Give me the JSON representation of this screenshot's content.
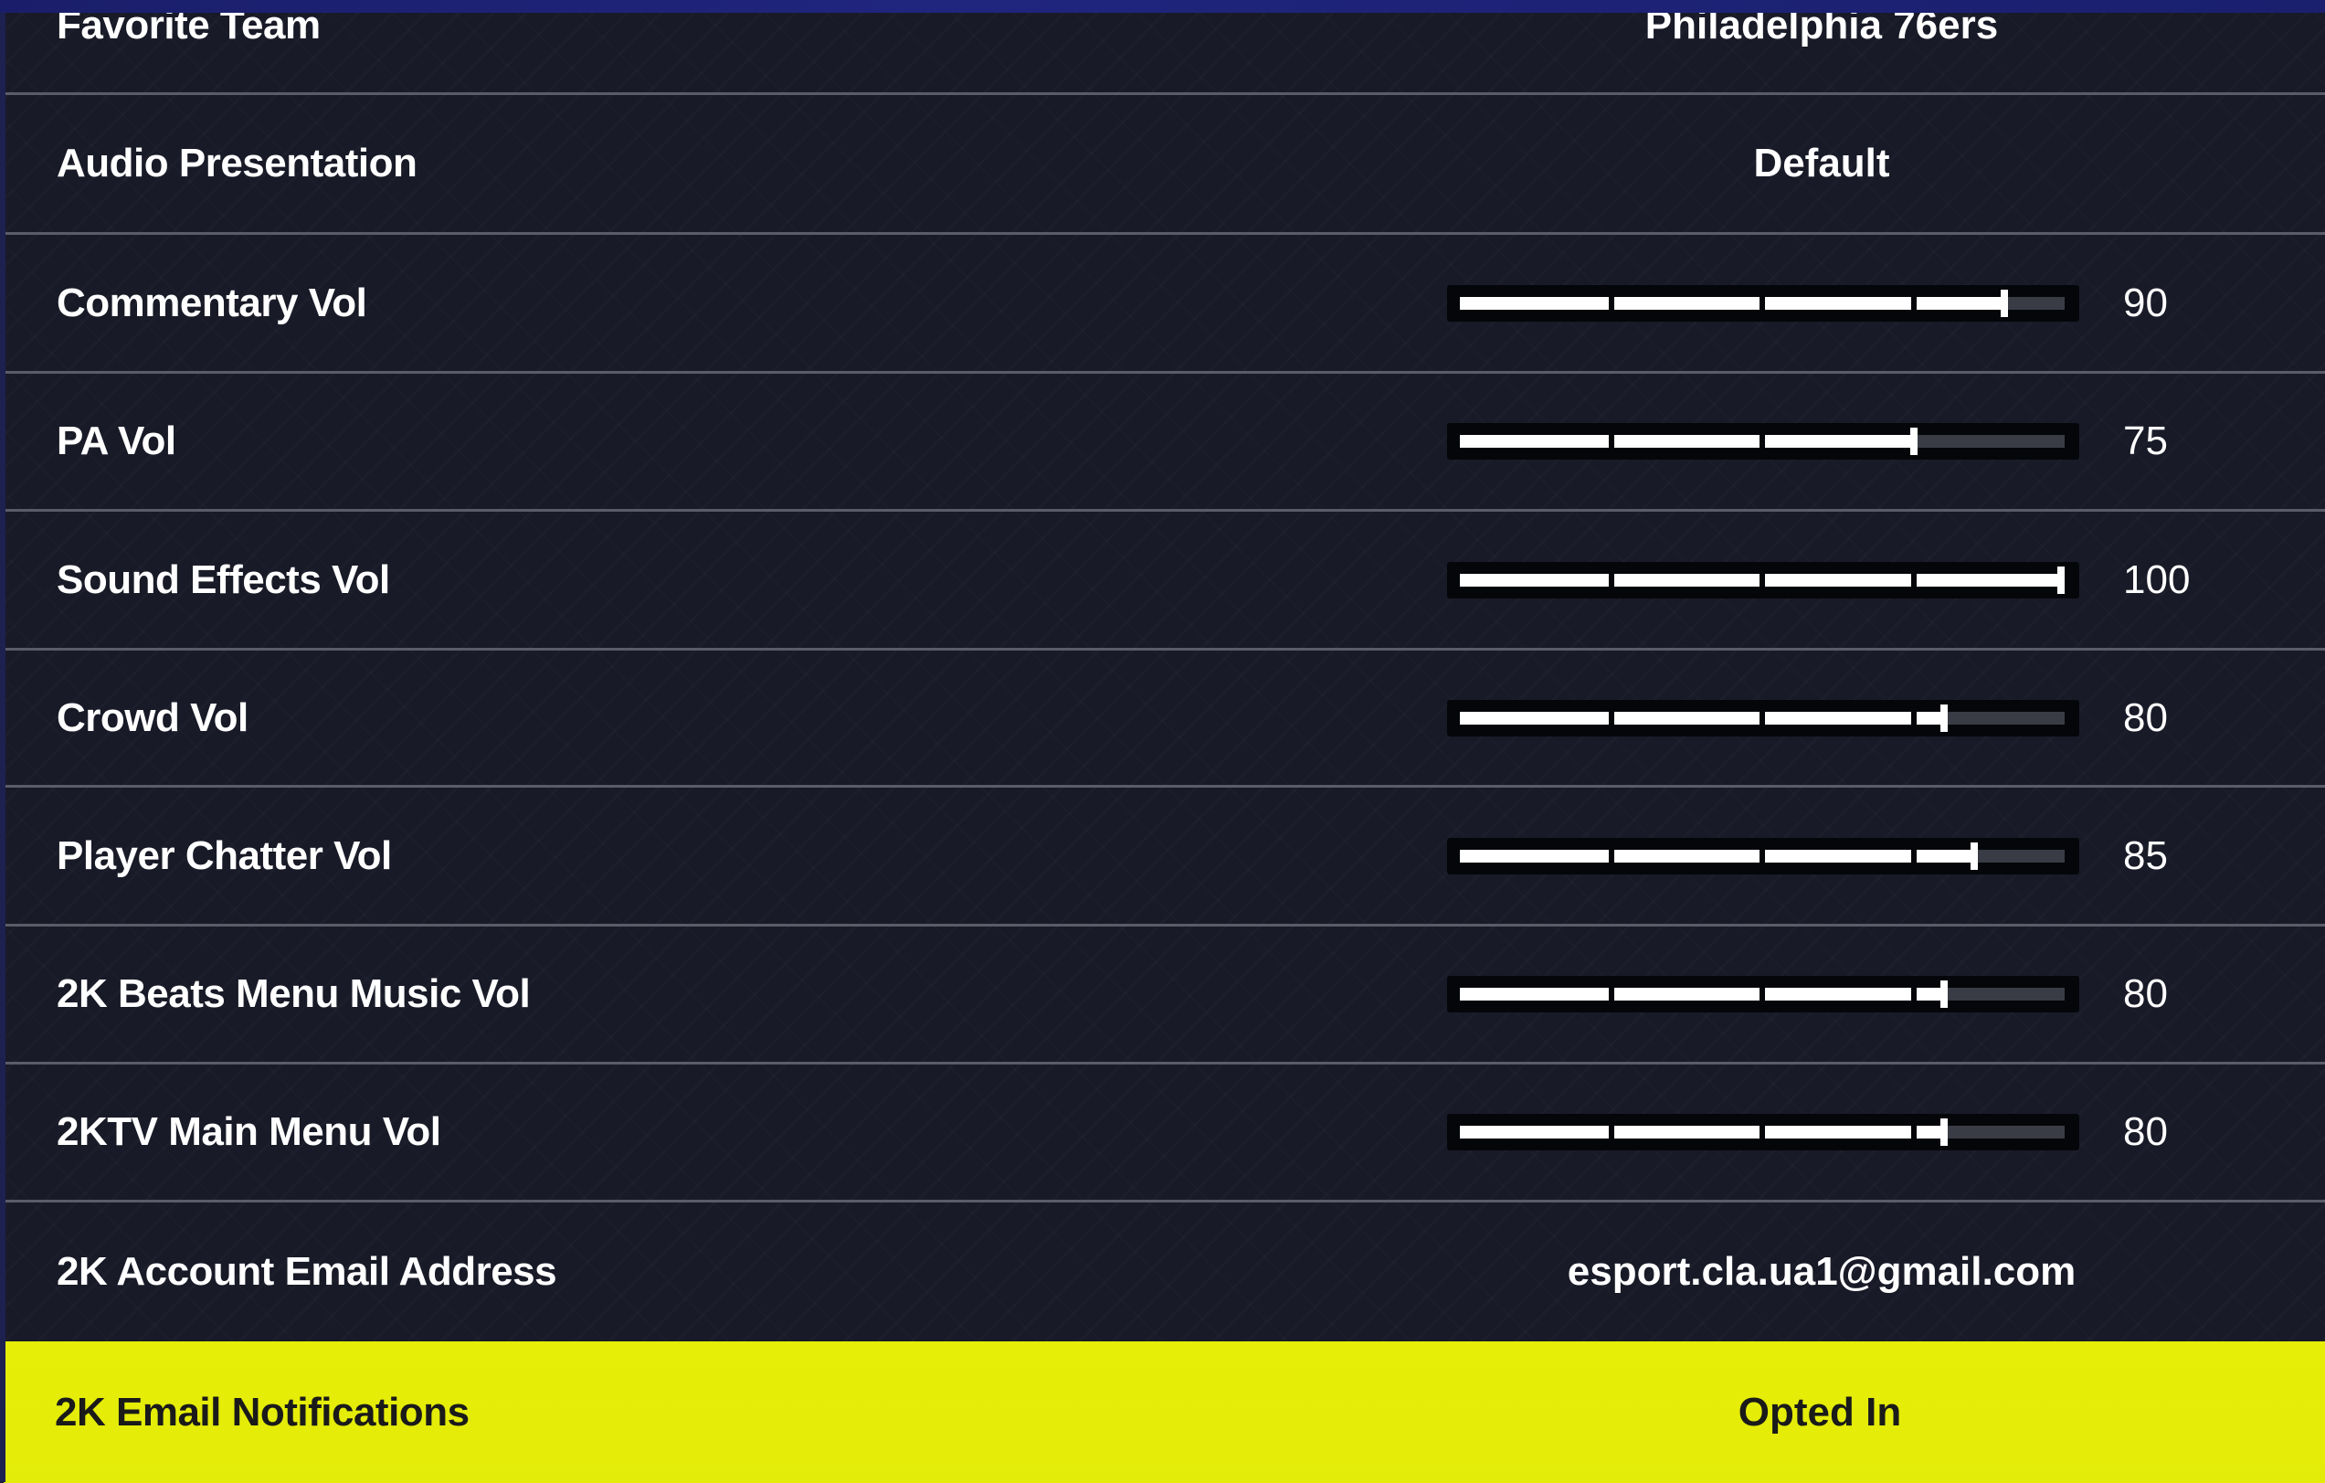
{
  "settings": [
    {
      "label": "Favorite Team",
      "type": "choice",
      "value": "Philadelphia 76ers"
    },
    {
      "label": "Audio Presentation",
      "type": "choice",
      "value": "Default"
    },
    {
      "label": "Commentary Vol",
      "type": "slider",
      "value": "90",
      "level": 90
    },
    {
      "label": "PA Vol",
      "type": "slider",
      "value": "75",
      "level": 75
    },
    {
      "label": "Sound Effects Vol",
      "type": "slider",
      "value": "100",
      "level": 100
    },
    {
      "label": "Crowd Vol",
      "type": "slider",
      "value": "80",
      "level": 80
    },
    {
      "label": "Player Chatter Vol",
      "type": "slider",
      "value": "85",
      "level": 85
    },
    {
      "label": "2K Beats Menu Music Vol",
      "type": "slider",
      "value": "80",
      "level": 80
    },
    {
      "label": "2KTV Main Menu Vol",
      "type": "slider",
      "value": "80",
      "level": 80
    },
    {
      "label": "2K Account Email Address",
      "type": "choice",
      "value": "esport.cla.ua1@gmail.com"
    },
    {
      "label": "2K Email Notifications",
      "type": "choice",
      "value": "Opted In",
      "selected": true
    }
  ],
  "colors": {
    "background": "#181a27",
    "highlight": "#e6ee07",
    "divider": "#5a5d68",
    "slider_fill": "#ffffff",
    "slider_track": "#3a3c45"
  }
}
